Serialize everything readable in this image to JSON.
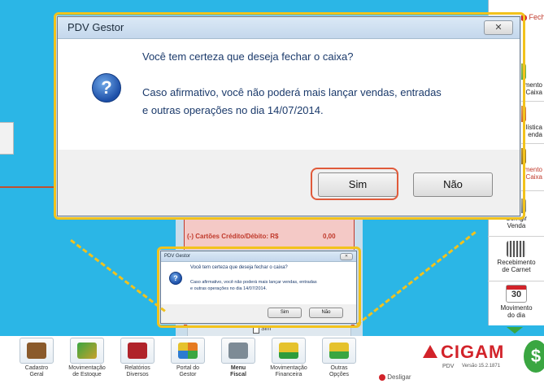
{
  "side_panel": {
    "close_label": "Fech",
    "items": [
      {
        "label": "mento\nCaixa",
        "icon": "refresh-cash-icon"
      },
      {
        "label": "lística\nenda",
        "icon": "user-chart-icon"
      },
      {
        "label": "mento\nCaixa",
        "icon": "cash-register-icon"
      },
      {
        "label": "Corrigir\nVenda",
        "icon": "pencil-icon"
      },
      {
        "label": "Recebimento\nde Carnet",
        "icon": "barcode-icon"
      },
      {
        "label": "Movimento\ndo dia",
        "icon": "calendar-icon"
      }
    ],
    "calendar_day": "30"
  },
  "background_form": {
    "line_label": "(-) Cartões Crédito/Débito: R$",
    "line_value": "0,00",
    "checkbox_label": "Sim"
  },
  "dialog": {
    "title": "PDV Gestor",
    "close_glyph": "✕",
    "question": "Você tem certeza que deseja fechar o caixa?",
    "message_line1": "Caso afirmativo, você não poderá mais lançar vendas, entradas",
    "message_line2": "e outras operações no dia 14/07/2014.",
    "yes_label": "Sim",
    "no_label": "Não"
  },
  "toolbar": {
    "items": [
      {
        "label": "Cadastro\nGeral",
        "icon": "clipboard-icon",
        "color": "#8a5a2b"
      },
      {
        "label": "Movimentação\nde Estoque",
        "icon": "stock-hand-icon",
        "color": "#c8a12c"
      },
      {
        "label": "Relatórios\nDiversos",
        "icon": "book-icon",
        "color": "#b0232a"
      },
      {
        "label": "Portal do\nGestor",
        "icon": "portal-icon",
        "color": "#e57a1f"
      },
      {
        "label": "Menu\nFiscal",
        "icon": "printer-icon",
        "color": "#7d8b96"
      },
      {
        "label": "Movimentação\nFinanceira",
        "icon": "money-icon",
        "color": "#2e9c3c"
      },
      {
        "label": "Outras\nOpções",
        "icon": "plus-icon",
        "color": "#3aa641"
      }
    ],
    "logout_label": "Desligar",
    "brand": "CIGAM",
    "brand_sub": "PDV",
    "version": "Versão 15.2.1871"
  },
  "colors": {
    "background": "#2bb6e6",
    "highlight": "#f2c21c",
    "callout_line": "#c0502f",
    "brand_red": "#d2232a"
  }
}
